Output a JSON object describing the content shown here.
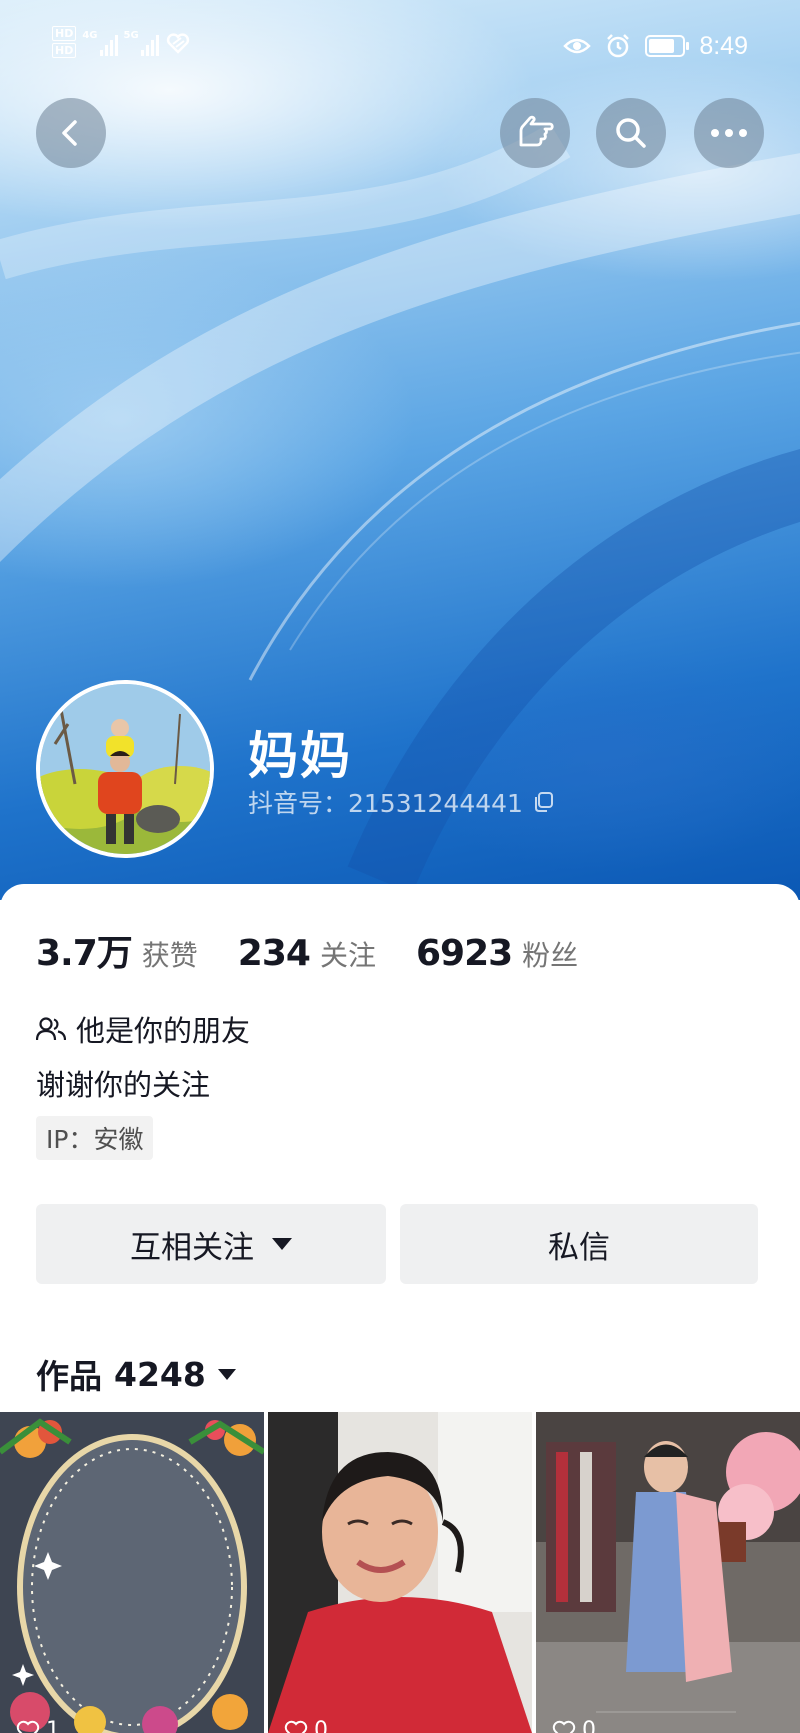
{
  "status_bar": {
    "hd1": "HD",
    "hd2": "HD",
    "network1": "4G",
    "network2": "5G",
    "time": "8:49",
    "battery_level": 0.8
  },
  "nav": {
    "back": "back-icon",
    "gesture": "pointing-hand-icon",
    "search": "search-icon",
    "more": "more-icon"
  },
  "profile": {
    "nickname": "妈妈",
    "douyin_id": "抖音号：21531244441"
  },
  "stats": [
    {
      "value": "3.7万",
      "label": "获赞"
    },
    {
      "value": "234",
      "label": "关注"
    },
    {
      "value": "6923",
      "label": "粉丝"
    }
  ],
  "friend_text": "他是你的朋友",
  "bio": "谢谢你的关注",
  "ip_label": "IP：安徽",
  "actions": {
    "follow_label": "互相关注",
    "message_label": "私信"
  },
  "works": {
    "title": "作品",
    "count": "4248",
    "thumbs": [
      {
        "likes": "1"
      },
      {
        "likes": "0"
      },
      {
        "likes": "0"
      }
    ]
  },
  "colors": {
    "cover_blue": "#1f73cb",
    "text_primary": "#161823",
    "text_secondary": "#757575",
    "button_bg": "#eff0f1"
  }
}
